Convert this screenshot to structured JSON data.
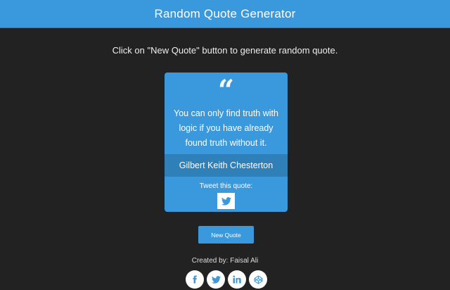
{
  "header": {
    "title": "Random Quote Generator"
  },
  "intro": {
    "instructions": "Click on \"New Quote\" button to generate random quote."
  },
  "quote_card": {
    "quote_icon": "quote-left-icon",
    "text": "You can only find truth with logic if you have already found truth without it.",
    "author": "Gilbert Keith Chesterton",
    "tweet_label": "Tweet this quote:",
    "tweet_icon": "twitter-icon"
  },
  "actions": {
    "new_quote_label": "New Quote"
  },
  "footer": {
    "credit": "Created by: Faisal Ali",
    "social_icons": [
      "facebook-icon",
      "twitter-icon",
      "linkedin-icon",
      "codepen-icon"
    ]
  },
  "colors": {
    "background": "#222222",
    "accent": "#3a99dc",
    "author_bar": "#2f7fb8",
    "text": "#ffffff"
  }
}
